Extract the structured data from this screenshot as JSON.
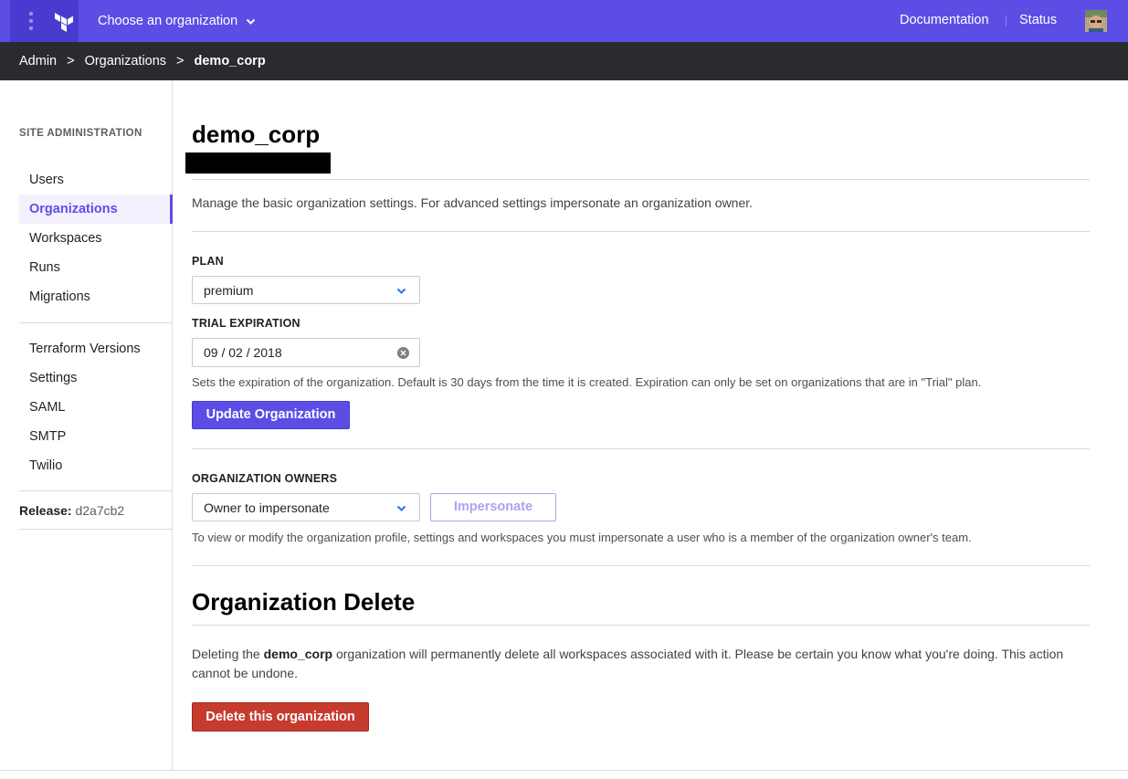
{
  "topbar": {
    "org_chooser_label": "Choose an organization",
    "documentation_label": "Documentation",
    "status_label": "Status",
    "brand_color": "#5c4ee5"
  },
  "breadcrumb": {
    "items": [
      "Admin",
      "Organizations",
      "demo_corp"
    ],
    "separator": ">"
  },
  "sidebar": {
    "heading": "SITE ADMINISTRATION",
    "group1": [
      "Users",
      "Organizations",
      "Workspaces",
      "Runs",
      "Migrations"
    ],
    "group2": [
      "Terraform Versions",
      "Settings",
      "SAML",
      "SMTP",
      "Twilio"
    ],
    "active_item": "Organizations",
    "release_label": "Release:",
    "release_value": "d2a7cb2"
  },
  "main": {
    "title": "demo_corp",
    "intro": "Manage the basic organization settings. For advanced settings impersonate an organization owner.",
    "plan_label": "PLAN",
    "plan_value": "premium",
    "trial_label": "TRIAL EXPIRATION",
    "trial_value": "09 / 02 / 2018",
    "trial_hint": "Sets the expiration of the organization. Default is 30 days from the time it is created. Expiration can only be set on organizations that are in \"Trial\" plan.",
    "update_button": "Update Organization",
    "owners_label": "ORGANIZATION OWNERS",
    "owners_placeholder": "Owner to impersonate",
    "impersonate_button": "Impersonate",
    "owners_hint": "To view or modify the organization profile, settings and workspaces you must impersonate a user who is a member of the organization owner's team.",
    "delete_heading": "Organization Delete",
    "delete_text_prefix": "Deleting the",
    "delete_text_org": "demo_corp",
    "delete_text_suffix": "organization will permanently delete all workspaces associated with it. Please be certain you know what you're doing. This action cannot be undone.",
    "delete_button": "Delete this organization",
    "danger_color": "#c73b2f"
  }
}
